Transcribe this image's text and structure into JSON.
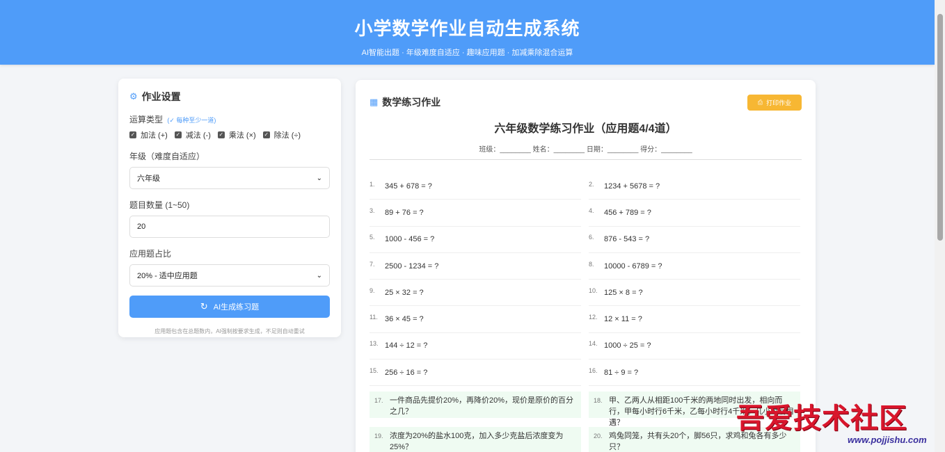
{
  "header": {
    "title": "小学数学作业自动生成系统",
    "subtitle": "AI智能出题 · 年级难度自适应 · 趣味应用题 · 加减乘除混合运算"
  },
  "settings": {
    "title": "作业设置",
    "op_label": "运算类型",
    "op_hint": "(✓ 每种至少一道)",
    "ops": [
      "加法 (+)",
      "减法 (-)",
      "乘法 (×)",
      "除法 (÷)"
    ],
    "grade_label": "年级（难度自适应）",
    "grade_value": "六年级",
    "count_label": "题目数量 (1~50)",
    "count_value": "20",
    "ratio_label": "应用题占比",
    "ratio_value": "20% - 适中应用题",
    "generate_label": "AI生成练习题",
    "note": "应用题包含在总题数内，AI强制按要求生成，不足则自动重试"
  },
  "worksheet": {
    "title": "数学练习作业",
    "print_label": "打印作业",
    "sheet_title": "六年级数学练习作业（应用题4/4道）",
    "info": "班级：________ 姓名：________ 日期：________ 得分：________",
    "problems": [
      {
        "num": "1.",
        "text": "345 + 678 = ?"
      },
      {
        "num": "2.",
        "text": "1234 + 5678 = ?"
      },
      {
        "num": "3.",
        "text": "89 + 76 = ?"
      },
      {
        "num": "4.",
        "text": "456 + 789 = ?"
      },
      {
        "num": "5.",
        "text": "1000 - 456 = ?"
      },
      {
        "num": "6.",
        "text": "876 - 543 = ?"
      },
      {
        "num": "7.",
        "text": "2500 - 1234 = ?"
      },
      {
        "num": "8.",
        "text": "10000 - 6789 = ?"
      },
      {
        "num": "9.",
        "text": "25 × 32 = ?"
      },
      {
        "num": "10.",
        "text": "125 × 8 = ?"
      },
      {
        "num": "11.",
        "text": "36 × 45 = ?"
      },
      {
        "num": "12.",
        "text": "12 × 11 = ?"
      },
      {
        "num": "13.",
        "text": "144 ÷ 12 = ?"
      },
      {
        "num": "14.",
        "text": "1000 ÷ 25 = ?"
      },
      {
        "num": "15.",
        "text": "256 ÷ 16 = ?"
      },
      {
        "num": "16.",
        "text": "81 ÷ 9 = ?"
      }
    ],
    "applications": [
      {
        "num": "17.",
        "text": "一件商品先提价20%，再降价20%，现价是原价的百分之几？"
      },
      {
        "num": "18.",
        "text": "甲、乙两人从相距100千米的两地同时出发，相向而行，甲每小时行6千米，乙每小时行4千米，几小时后相遇？"
      },
      {
        "num": "19.",
        "text": "浓度为20%的盐水100克，加入多少克盐后浓度变为25%？"
      },
      {
        "num": "20.",
        "text": "鸡兔同笼，共有头20个，脚56只，求鸡和兔各有多少只？"
      }
    ]
  },
  "watermark": {
    "text": "吾爱技术社区",
    "url": "www.pojjishu.com"
  }
}
